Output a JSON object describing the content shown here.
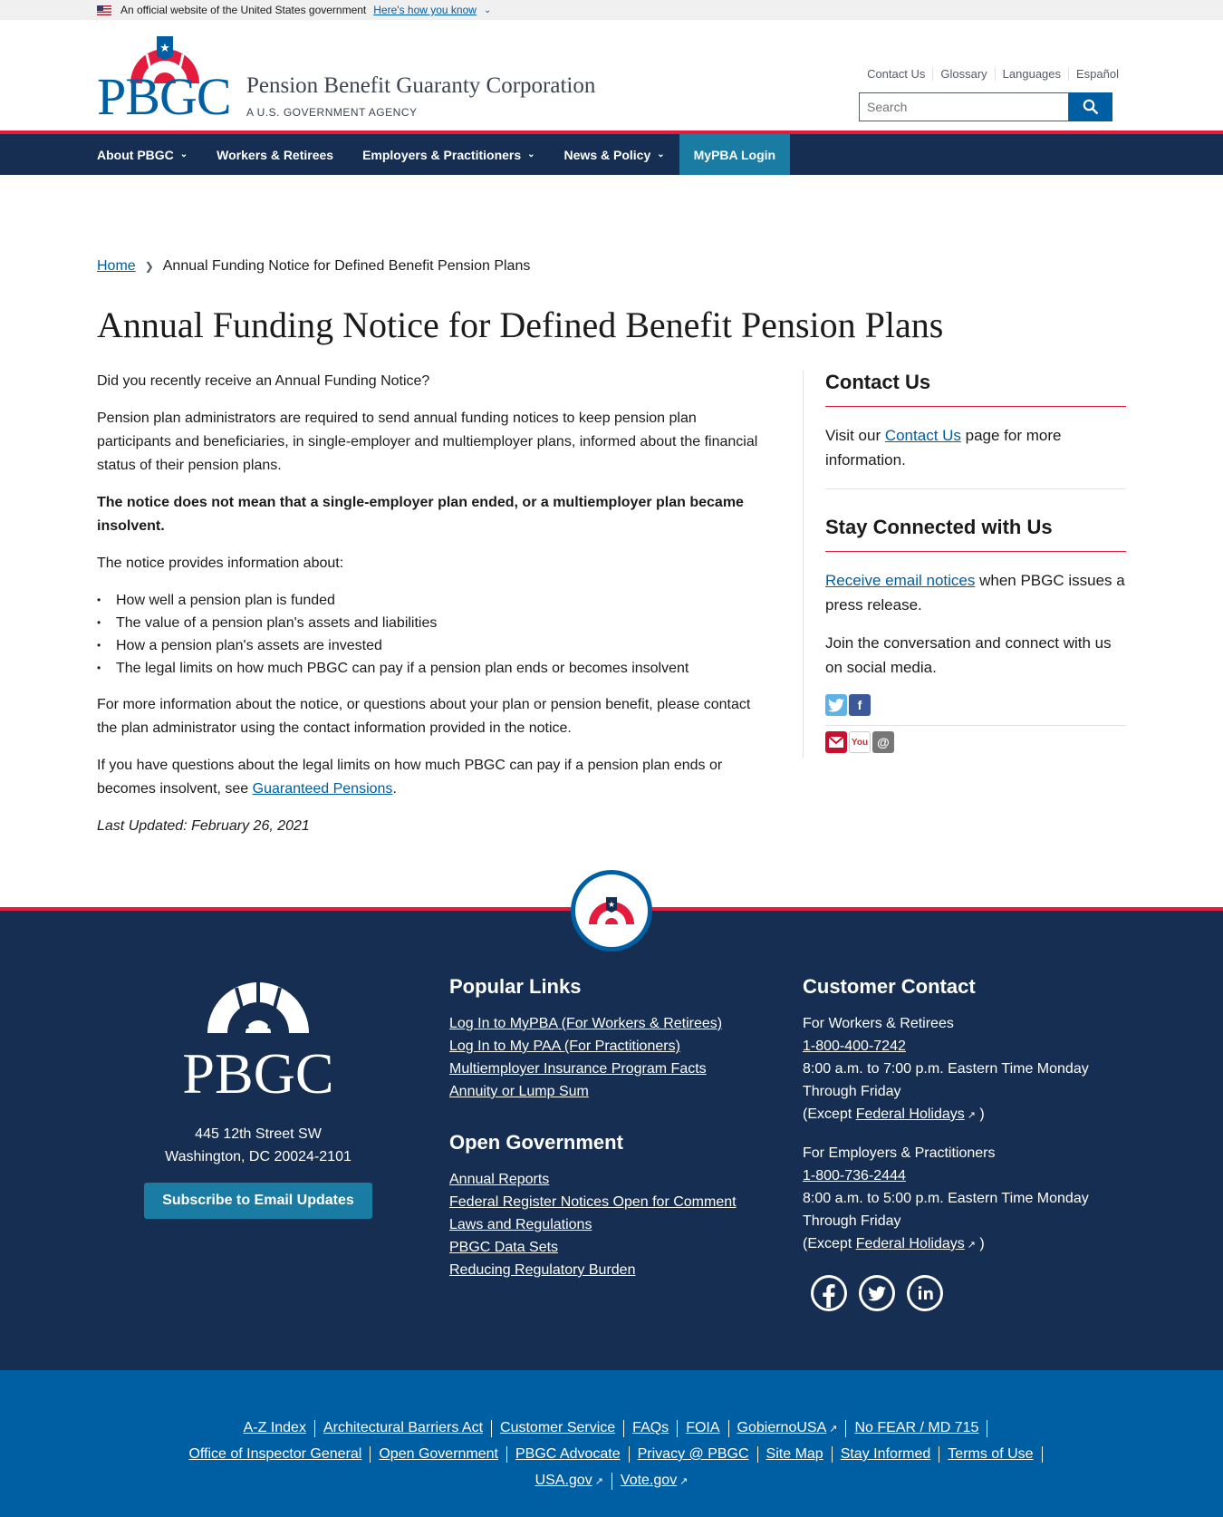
{
  "gov_banner": {
    "text": "An official website of the United States government",
    "link": "Here's how you know"
  },
  "header": {
    "logo_text": "PBGC",
    "agency_name": "Pension Benefit Guaranty Corporation",
    "agency_sub": "A U.S. GOVERNMENT AGENCY",
    "util_links": [
      "Contact Us",
      "Glossary",
      "Languages",
      "Español"
    ],
    "search_placeholder": "Search"
  },
  "nav": {
    "items": [
      {
        "label": "About PBGC",
        "dropdown": true
      },
      {
        "label": "Workers & Retirees",
        "dropdown": false
      },
      {
        "label": "Employers & Practitioners",
        "dropdown": true
      },
      {
        "label": "News & Policy",
        "dropdown": true
      }
    ],
    "login": "MyPBA Login"
  },
  "breadcrumb": {
    "home": "Home",
    "current": "Annual Funding Notice for Defined Benefit Pension Plans"
  },
  "main": {
    "title": "Annual Funding Notice for Defined Benefit Pension Plans",
    "p1": "Did you recently receive an Annual Funding Notice?",
    "p2": "Pension plan administrators are required to send annual funding notices to keep pension plan participants and beneficiaries, in single-employer and multiemployer plans, informed about the financial status of their pension plans.",
    "p3": "The notice does not mean that a single-employer plan ended, or a multiemployer plan became insolvent.",
    "p4": "The notice provides information about:",
    "bullets": [
      "How well a pension plan is funded",
      "The value of a pension plan's assets and liabilities",
      "How a pension plan's assets are invested",
      "The legal limits on how much PBGC can pay if a pension plan ends or becomes insolvent"
    ],
    "p5": "For more information about the notice, or questions about your plan or pension benefit, please contact the plan administrator using the contact information provided in the notice.",
    "p6_pre": "If you have questions about the legal limits on how much PBGC can pay if a pension plan ends or becomes insolvent, see ",
    "p6_link": "Guaranteed Pensions",
    "p6_post": ".",
    "updated": "Last Updated: February 26, 2021"
  },
  "sidebar": {
    "contact_title": "Contact Us",
    "contact_pre": "Visit our ",
    "contact_link": "Contact Us",
    "contact_post": " page for more information.",
    "stay_title": "Stay Connected with Us",
    "email_link": "Receive email notices",
    "email_post": " when PBGC issues a press release.",
    "join_text": "Join the conversation and connect with us on social media.",
    "icons": [
      "twitter-icon",
      "facebook-icon",
      "email-icon",
      "youtube-icon",
      "at-icon"
    ]
  },
  "footer": {
    "logo_text": "PBGC",
    "address_line1": "445 12th Street SW",
    "address_line2": "Washington, DC 20024-2101",
    "subscribe": "Subscribe to Email Updates",
    "popular_title": "Popular Links",
    "popular_links": [
      "Log In to MyPBA (For Workers & Retirees)",
      "Log In to My PAA (For Practitioners)",
      "Multiemployer Insurance Program Facts",
      "Annuity or Lump Sum"
    ],
    "open_gov_title": "Open Government",
    "open_gov_links": [
      "Annual Reports",
      "Federal Register Notices Open for Comment",
      "Laws and Regulations",
      "PBGC Data Sets",
      "Reducing Regulatory Burden"
    ],
    "contact_title": "Customer Contact",
    "workers": {
      "label": "For Workers & Retirees",
      "phone": "1-800-400-7242",
      "hours": "8:00 a.m. to 7:00 p.m. Eastern Time Monday Through Friday",
      "except_pre": "(Except ",
      "except_link": "Federal Holidays",
      "except_post": ")"
    },
    "employers": {
      "label": "For Employers & Practitioners",
      "phone": "1-800-736-2444",
      "hours": "8:00 a.m. to 5:00 p.m. Eastern Time Monday Through Friday",
      "except_pre": "(Except ",
      "except_link": "Federal Holidays",
      "except_post": ")"
    },
    "social": [
      "facebook-icon",
      "twitter-icon",
      "linkedin-icon"
    ]
  },
  "bottom_links": {
    "row1": [
      "A-Z Index",
      "Architectural Barriers Act",
      "Customer Service",
      "FAQs",
      "FOIA",
      "GobiernoUSA",
      "No FEAR / MD 715"
    ],
    "row2": [
      "Office of Inspector General",
      "Open Government",
      "PBGC Advocate",
      "Privacy @ PBGC",
      "Site Map",
      "Stay Informed",
      "Terms of Use"
    ],
    "row3": [
      "USA.gov",
      "Vote.gov"
    ]
  },
  "colors": {
    "navy": "#162e51",
    "blue": "#005ea2",
    "red": "#e31c3d",
    "teal": "#1a7ba3"
  }
}
